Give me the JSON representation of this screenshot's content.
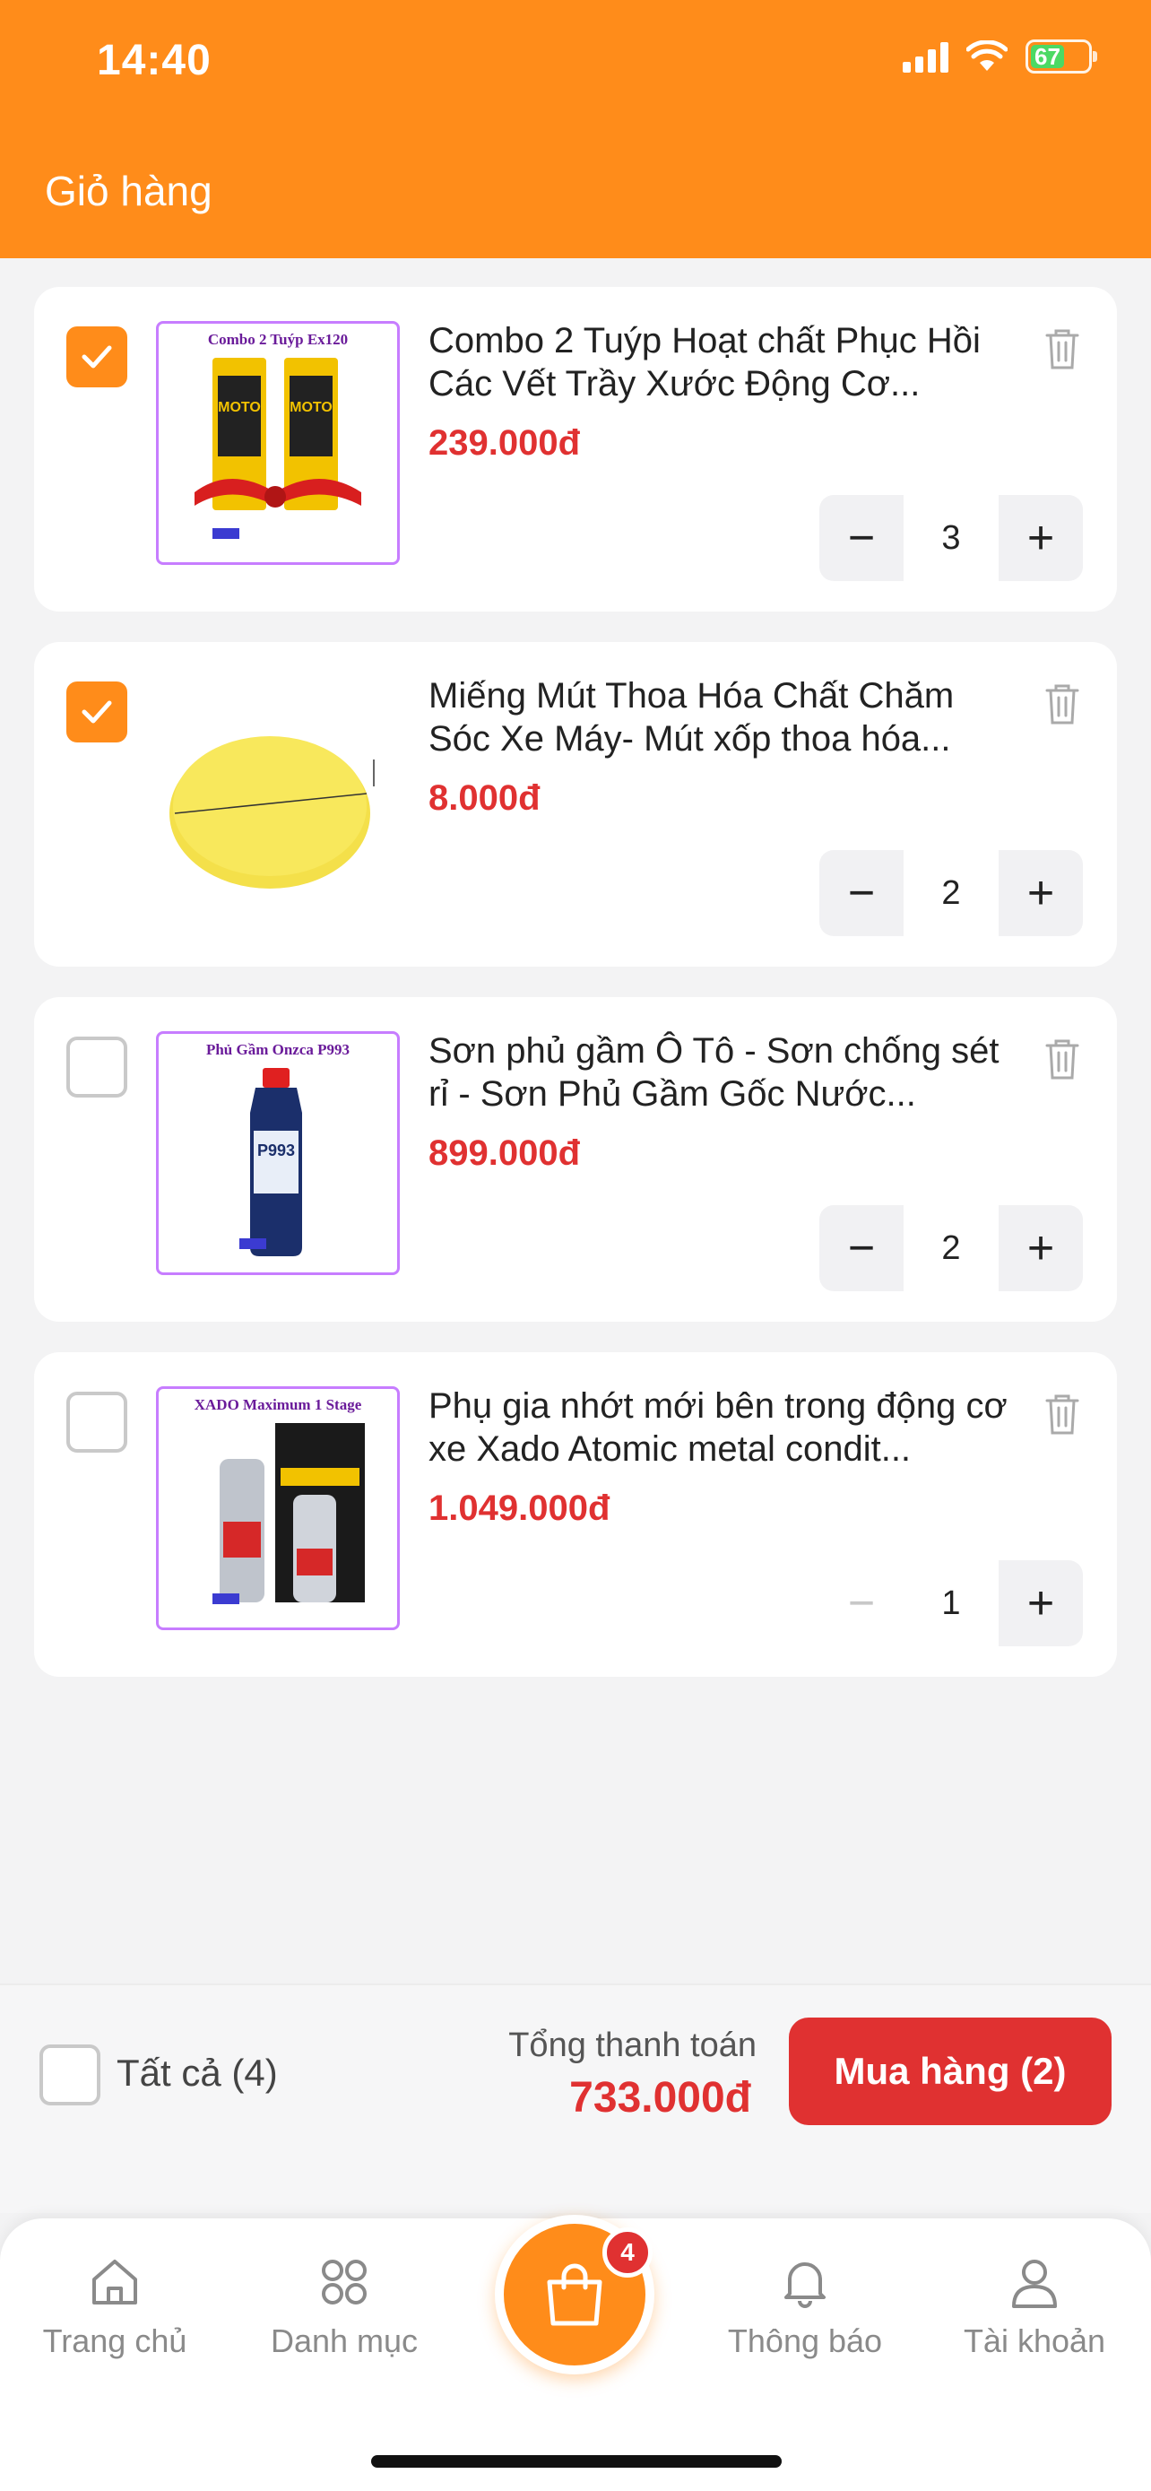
{
  "status_bar": {
    "time": "14:40",
    "battery": "67"
  },
  "header": {
    "title": "Giỏ hàng"
  },
  "cart_items": [
    {
      "name": "Combo 2 Tuýp Hoạt chất Phục Hồi Các Vết Trầy Xước Động Cơ...",
      "price": "239.000đ",
      "quantity": "3",
      "checked": true,
      "image_caption": "Combo 2 Tuýp Ex120",
      "image_icon": "tube-product-image"
    },
    {
      "name": "Miếng Mút Thoa Hóa Chất Chăm Sóc Xe Máy- Mút xốp thoa hóa...",
      "price": "8.000đ",
      "quantity": "2",
      "checked": true,
      "image_caption": "",
      "image_icon": "sponge-product-image"
    },
    {
      "name": "Sơn phủ gầm Ô Tô - Sơn chống sét rỉ - Sơn Phủ Gầm Gốc Nước...",
      "price": "899.000đ",
      "quantity": "2",
      "checked": false,
      "image_caption": "Phủ Gầm Onzca P993",
      "image_icon": "bottle-product-image"
    },
    {
      "name": "Phụ gia nhớt mới bên trong động cơ xe Xado Atomic metal condit...",
      "price": "1.049.000đ",
      "quantity": "1",
      "checked": false,
      "image_caption": "XADO Maximum 1 Stage",
      "image_icon": "can-product-image"
    }
  ],
  "summary": {
    "select_all_label": "Tất cả (4)",
    "total_label": "Tổng thanh toán",
    "total_value": "733.000đ",
    "buy_button_label": "Mua hàng (2)"
  },
  "bottom_nav": {
    "home": "Trang chủ",
    "categories": "Danh mục",
    "cart_badge": "4",
    "notifications": "Thông báo",
    "account": "Tài khoản"
  },
  "colors": {
    "accent": "#ff8c1a",
    "price": "#e03131",
    "buy": "#e03131"
  }
}
